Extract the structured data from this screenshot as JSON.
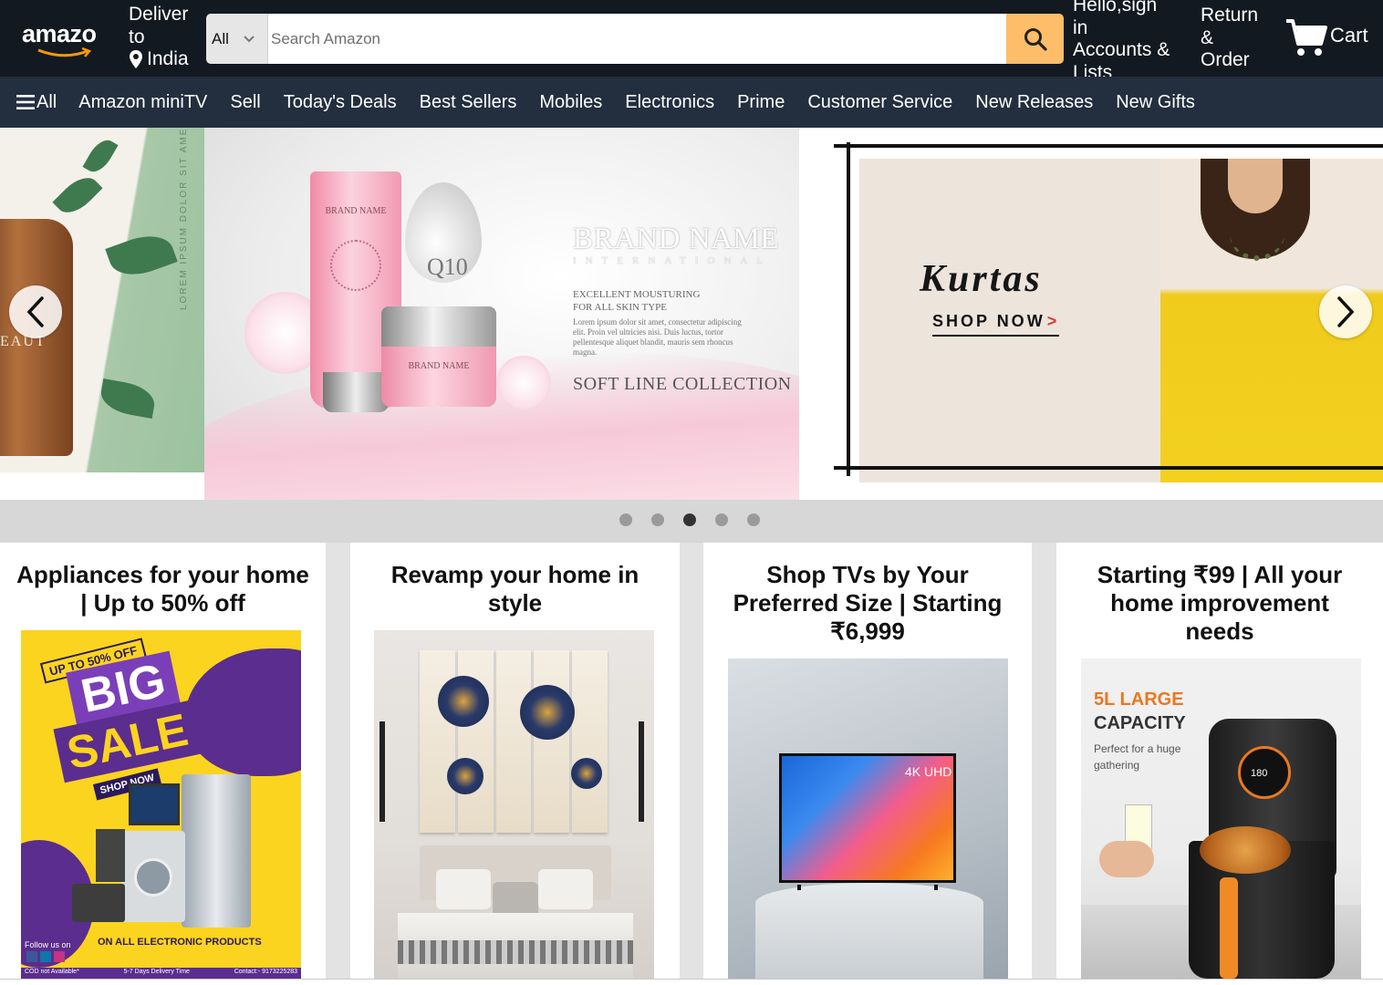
{
  "header": {
    "logo_text": "amazo",
    "deliver_line1": "Deliver",
    "deliver_line2": "to",
    "deliver_location": "India",
    "search_category": "All",
    "search_placeholder": "Search Amazon",
    "account_line1": "Hello,sign",
    "account_line2": "in",
    "account_line3": "Accounts &",
    "account_line4": "Lists",
    "returns_line1": "Return",
    "returns_line2": "&",
    "returns_line3": "Order",
    "cart_label": "Cart"
  },
  "nav": {
    "all_label": "All",
    "items": [
      "Amazon miniTV",
      "Sell",
      "Today's Deals",
      "Best Sellers",
      "Mobiles",
      "Electronics",
      "Prime",
      "Customer Service",
      "New Releases",
      "New Gifts"
    ]
  },
  "hero": {
    "left_partial_text": "EAUT",
    "left_vertical_text": "LOREM IPSUM DOLOR SIT AMET",
    "main": {
      "tube_brand": "BRAND NAME",
      "jar_brand": "BRAND NAME",
      "drop_label": "Q10",
      "brand_title": "BRAND NAME",
      "brand_subtitle": "INTERNATIONAL",
      "desc_line1": "EXCELLENT MOUSTURING",
      "desc_line2": "FOR ALL SKIN TYPE",
      "lorem": "Lorem ipsum dolor sit amet, consectetur adipiscing elit. Proin vel ultricies nisi. Duis luctus, tortor pellentesque aliquet blandit, mauris sem rhoncus magna.",
      "collection": "SOFT LINE COLLECTION"
    },
    "right": {
      "title": "Kurtas",
      "cta": "SHOP NOW",
      "cta_arrow": ">"
    },
    "active_slide": 3,
    "slide_count": 5
  },
  "cards": [
    {
      "title": "Appliances for your home | Up to 50% off",
      "banner_badge": "UP TO 50% OFF",
      "banner_line1": "BIG",
      "banner_line2": "SALE",
      "banner_cta": "SHOP NOW",
      "banner_footer": "ON ALL ELECTRONIC PRODUCTS",
      "banner_follow": "Follow us on",
      "banner_cod": "COD not Available*",
      "banner_delivery": "5-7 Days Delivery Time",
      "banner_contact": "Contact:- 9173225283"
    },
    {
      "title": "Revamp your home in style"
    },
    {
      "title": "Shop TVs by Your Preferred Size | Starting ₹6,999",
      "tv_label": "4K UHD"
    },
    {
      "title": "Starting ₹99 | All your home improvement needs",
      "capacity_line1": "5L LARGE",
      "capacity_line2": "CAPACITY",
      "capacity_desc1": "Perfect for a huge",
      "capacity_desc2": "gathering",
      "display_value": "180"
    }
  ],
  "colors": {
    "header_bg": "#131921",
    "nav_bg": "#232f3e",
    "search_button": "#febd69",
    "accent": "#ff9900"
  },
  "icons": [
    "location-pin-icon",
    "chevron-down-icon",
    "search-icon",
    "cart-icon",
    "hamburger-menu-icon",
    "chevron-left-icon",
    "chevron-right-icon"
  ]
}
